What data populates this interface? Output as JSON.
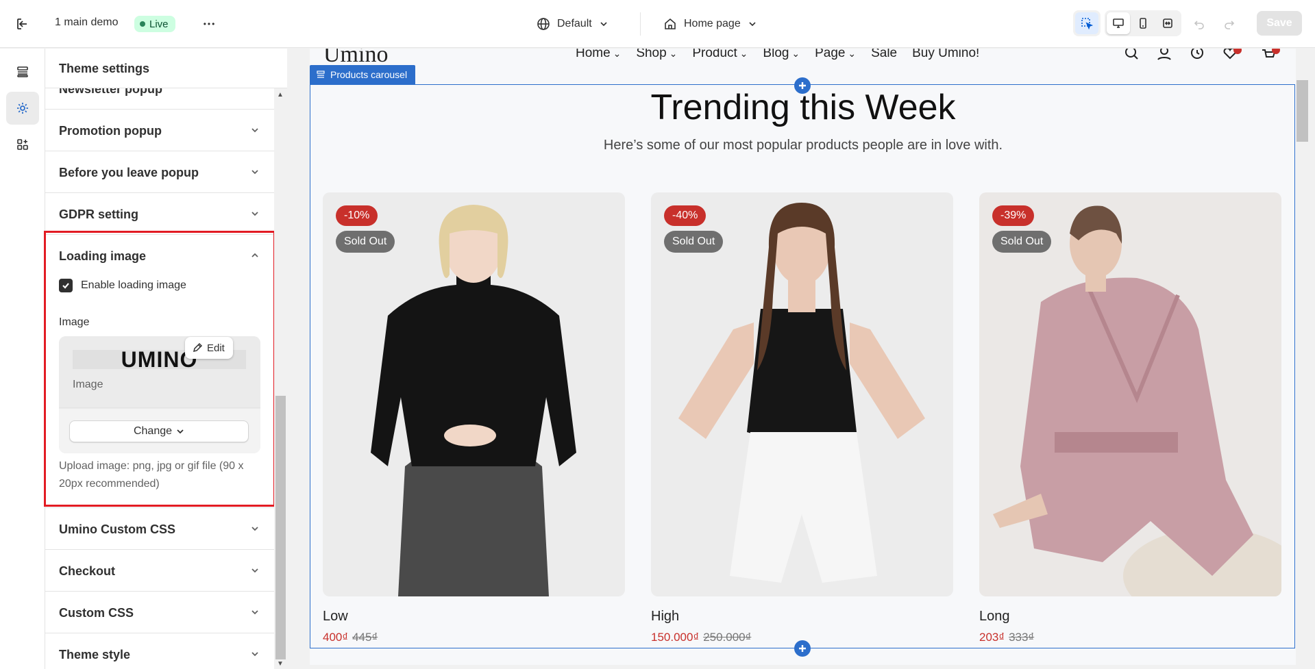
{
  "topbar": {
    "store_name": "1 main demo",
    "live_label": "Live",
    "more_label": "•••",
    "theme_selector": "Default",
    "page_selector": "Home page",
    "save_label": "Save"
  },
  "sidebar": {
    "header": "Theme settings",
    "partial_section": "Newsletter popup",
    "sections_above": [
      "Promotion popup",
      "Before you leave popup",
      "GDPR setting"
    ],
    "open_section": {
      "title": "Loading image",
      "checkbox_label": "Enable loading image",
      "checkbox_checked": true,
      "image_label": "Image",
      "image_preview_text": "UMINO",
      "image_caption": "Image",
      "edit_label": "Edit",
      "change_label": "Change",
      "hint": "Upload image: png, jpg or gif file (90 x 20px recommended)"
    },
    "sections_below": [
      "Umino Custom CSS",
      "Checkout",
      "Custom CSS",
      "Theme style"
    ]
  },
  "preview": {
    "logo": "Umino",
    "nav": [
      "Home",
      "Shop",
      "Product",
      "Blog",
      "Page",
      "Sale",
      "Buy Umino!"
    ],
    "section_tag": "Products carousel",
    "title": "Trending this Week",
    "subtitle": "Here’s some of our most popular products people are in love with.",
    "products": [
      {
        "name": "Low",
        "discount": "-10%",
        "status": "Sold Out",
        "price": "400₫",
        "compare_price": "445₫"
      },
      {
        "name": "High",
        "discount": "-40%",
        "status": "Sold Out",
        "price": "150.000₫",
        "compare_price": "250.000₫"
      },
      {
        "name": "Long",
        "discount": "-39%",
        "status": "Sold Out",
        "price": "203₫",
        "compare_price": "333₫"
      }
    ]
  },
  "colors": {
    "accent_blue": "#2c6ecb",
    "highlight_red": "#e21b23",
    "sale_red": "#c8302b",
    "live_green": "#29845a"
  },
  "icons": {
    "exit": "exit-icon",
    "globe": "globe-icon",
    "home": "home-icon",
    "select": "select-element-icon",
    "desktop": "desktop-icon",
    "mobile": "mobile-icon",
    "fullwidth": "fullwidth-icon",
    "undo": "undo-icon",
    "redo": "redo-icon",
    "sections": "sections-icon",
    "settings": "gear-icon",
    "apps": "apps-icon"
  }
}
